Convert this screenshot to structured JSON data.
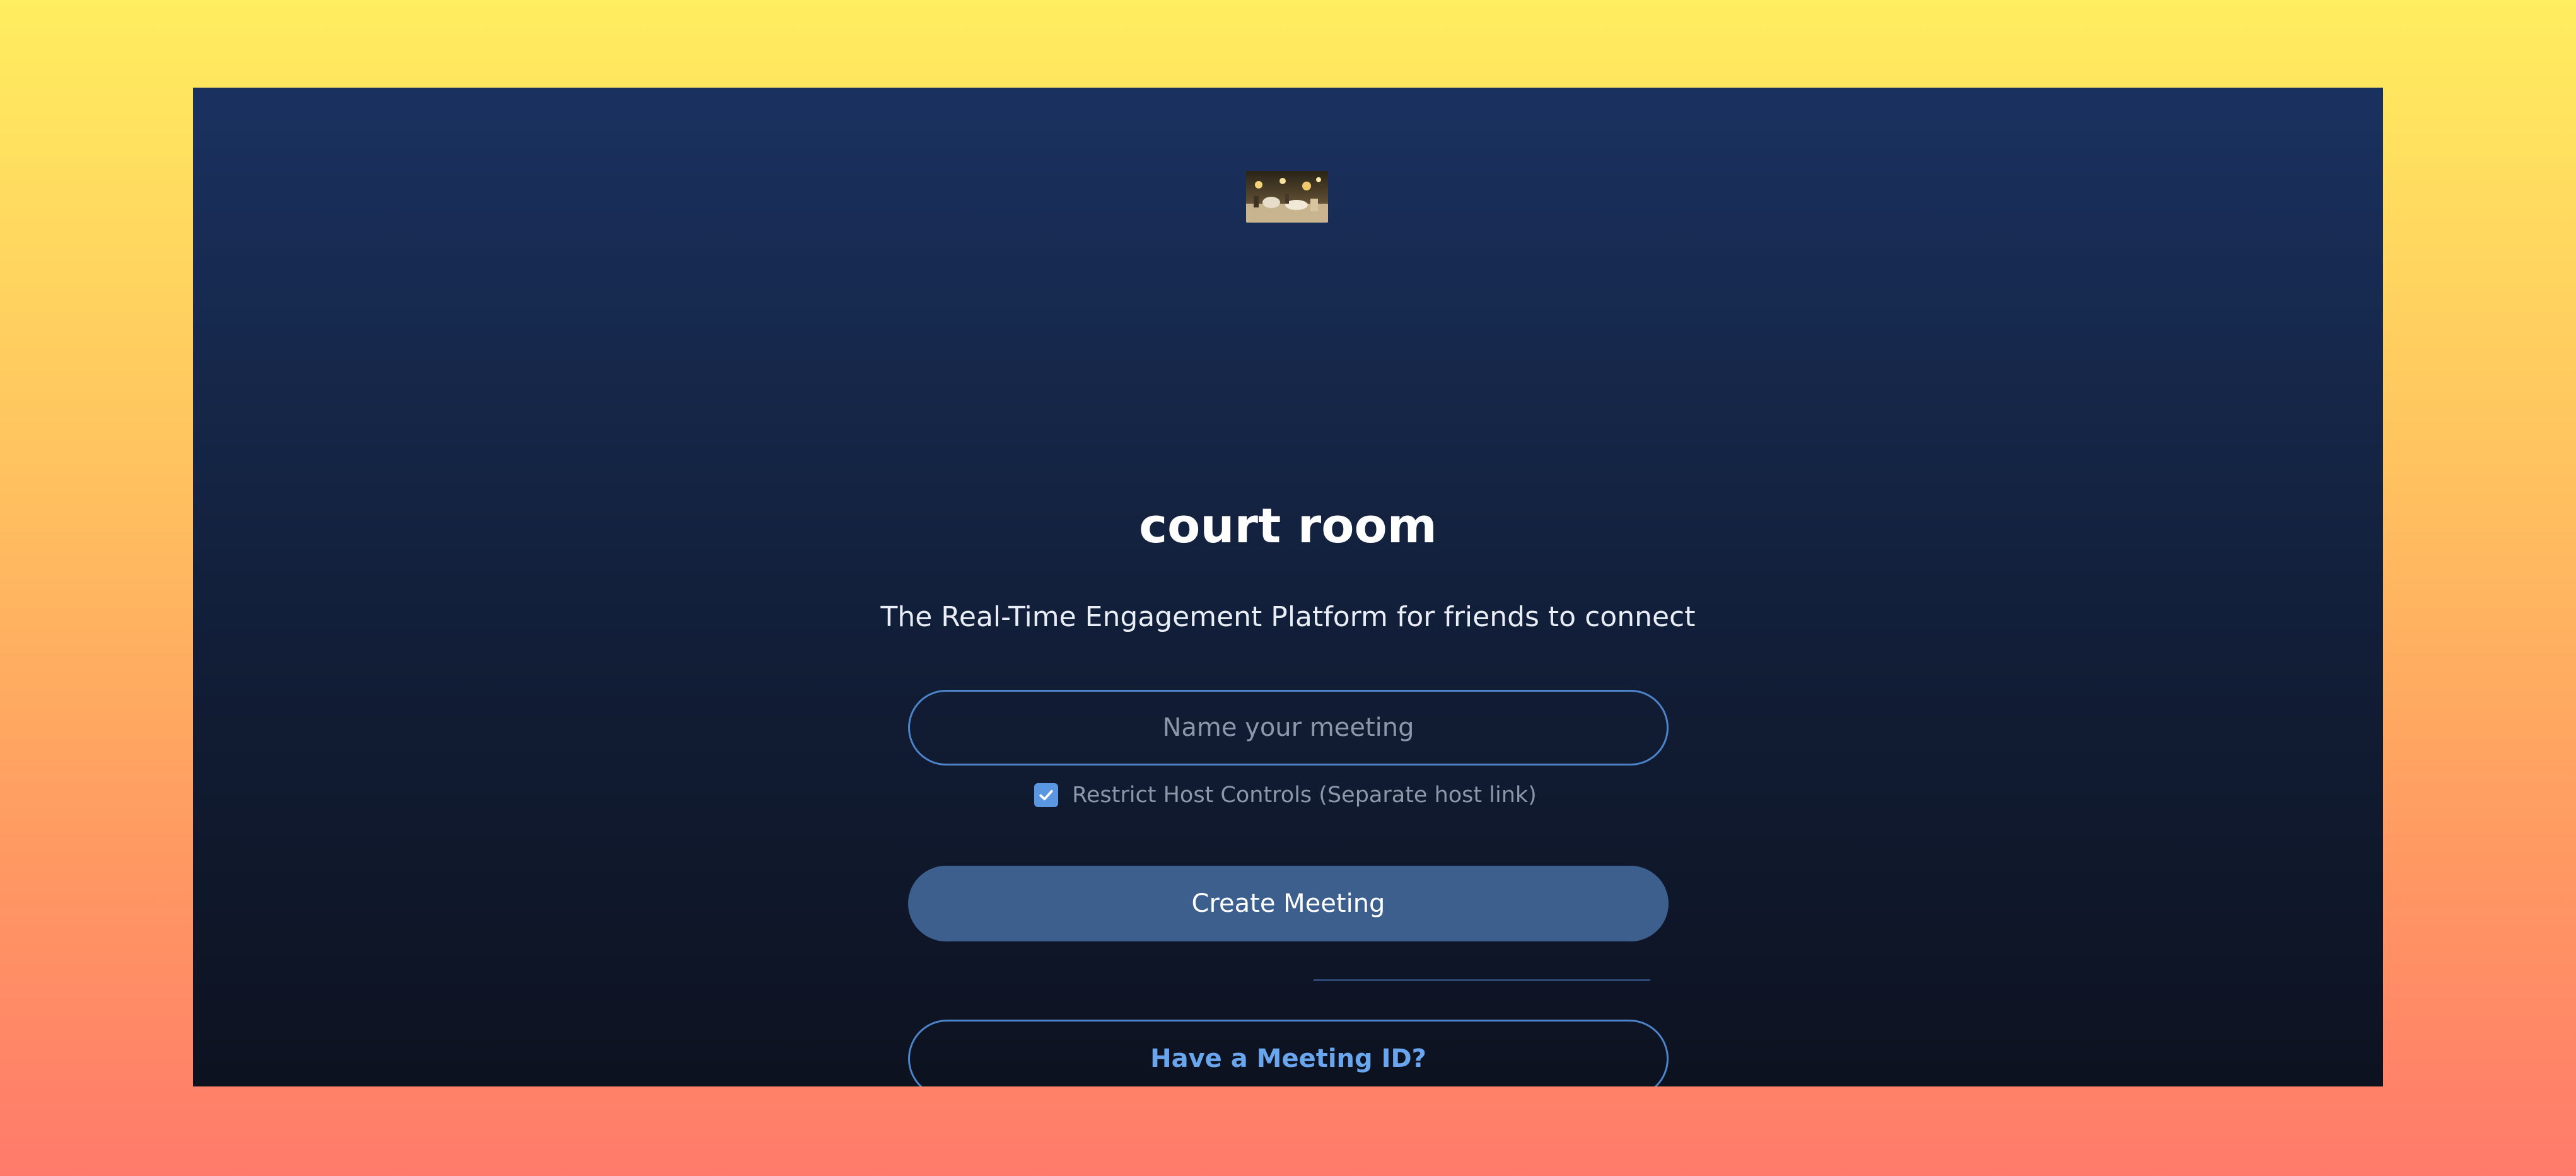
{
  "app": {
    "title": "court room",
    "subtitle": "The Real-Time Engagement Platform for friends to connect"
  },
  "logo": {
    "icon": "meeting-photo-logo"
  },
  "form": {
    "meeting_name": {
      "value": "",
      "placeholder": "Name your meeting"
    },
    "restrict_host_controls": {
      "checked": true,
      "label": "Restrict Host Controls (Separate host link)"
    },
    "create_button_label": "Create Meeting",
    "meeting_id_button_label": "Have a Meeting ID?"
  },
  "colors": {
    "accent": "#4d83c8",
    "primary_button": "#3d5f8d",
    "link_text": "#6aa6ee"
  }
}
